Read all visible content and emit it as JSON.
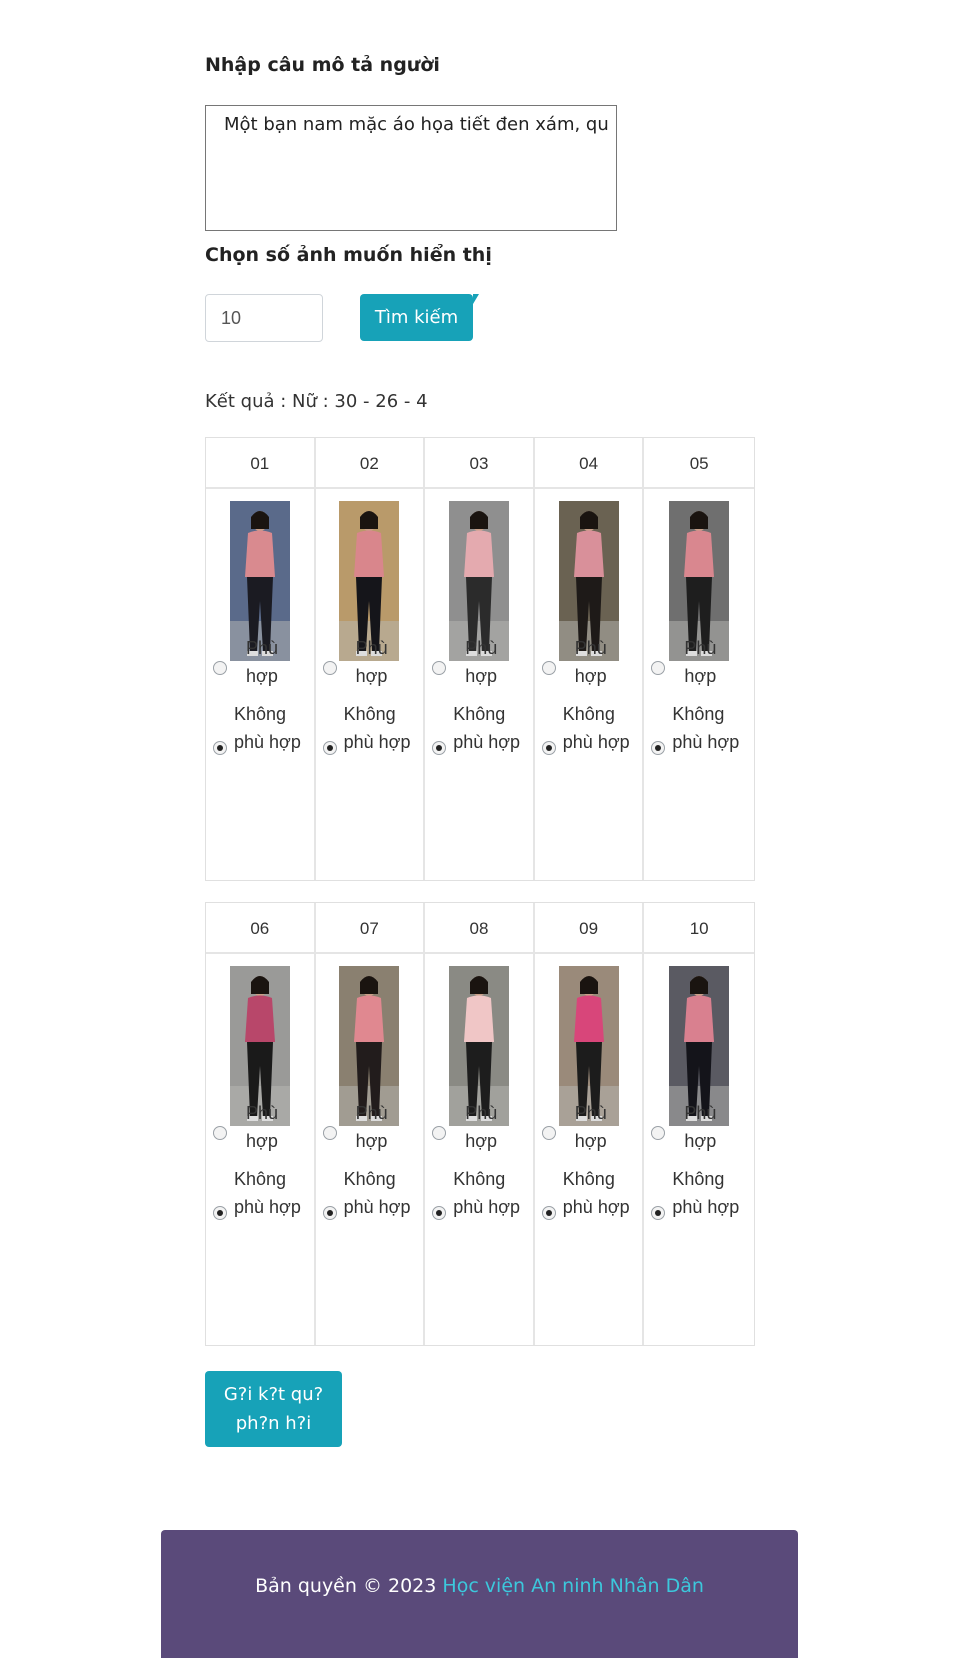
{
  "form": {
    "desc_label": "Nhập câu mô tả người",
    "desc_value": "Một bạn nam mặc áo họa tiết đen xám, qu",
    "count_label": "Chọn số ảnh muốn hiển thị",
    "count_value": "10",
    "search_label": "Tìm kiếm"
  },
  "result_text": "Kết quả : Nữ : 30 - 26 - 4",
  "option_match": "Phù hợp",
  "option_nomatch": "Không phù hợp",
  "cards": [
    {
      "id": "01",
      "shirt": "#d98a8f",
      "pants": "#1b1b22",
      "bg": "#5a6a8a",
      "selected": "nomatch"
    },
    {
      "id": "02",
      "shirt": "#d9868c",
      "pants": "#15151a",
      "bg": "#b99a6a",
      "selected": "nomatch"
    },
    {
      "id": "03",
      "shirt": "#e4aaaf",
      "pants": "#2b2b2b",
      "bg": "#8f8f8f",
      "selected": "nomatch"
    },
    {
      "id": "04",
      "shirt": "#d9909a",
      "pants": "#1e1a18",
      "bg": "#6a6252",
      "selected": "nomatch"
    },
    {
      "id": "05",
      "shirt": "#d9878f",
      "pants": "#1e1e1e",
      "bg": "#6f6f6f",
      "selected": "nomatch"
    },
    {
      "id": "06",
      "shirt": "#b8476a",
      "pants": "#1a1a1a",
      "bg": "#9a9a98",
      "selected": "nomatch"
    },
    {
      "id": "07",
      "shirt": "#e08890",
      "pants": "#221c1c",
      "bg": "#8a8070",
      "selected": "nomatch"
    },
    {
      "id": "08",
      "shirt": "#f0c6c6",
      "pants": "#1d1d1d",
      "bg": "#8a8a84",
      "selected": "nomatch"
    },
    {
      "id": "09",
      "shirt": "#d8467a",
      "pants": "#1c1c1c",
      "bg": "#9a8a7a",
      "selected": "nomatch"
    },
    {
      "id": "10",
      "shirt": "#d9808f",
      "pants": "#14141a",
      "bg": "#5a5a62",
      "selected": "nomatch"
    }
  ],
  "submit_label": "G?i k?t qu? ph?n h?i",
  "footer": {
    "text": "Bản quyền © 2023",
    "link": "Học viện An ninh Nhân Dân"
  },
  "colors": {
    "accent": "#17a2b8",
    "footer_bg": "#5a4a7a",
    "footer_link": "#3cc8dc"
  }
}
